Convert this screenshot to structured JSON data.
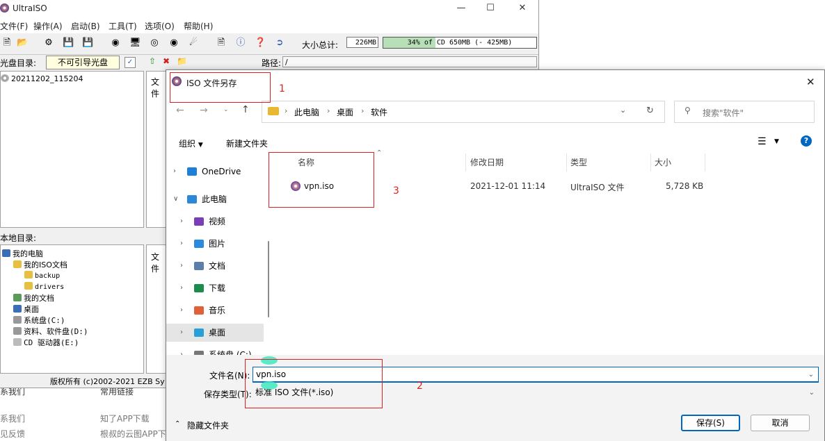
{
  "background_page": {
    "heading_left": "系我们",
    "heading_right": "常用链接",
    "links_left": [
      "系我们",
      "见反馈"
    ],
    "links_right": [
      "知了APP下载",
      "根叔的云图APP下载"
    ]
  },
  "ultraiso": {
    "title": "UltraISO",
    "menu": [
      "文件(F)",
      "操作(A)",
      "启动(B)",
      "工具(T)",
      "选项(O)",
      "帮助(H)"
    ],
    "size_label": "大小总计:",
    "size_value": "226MB",
    "capacity_text": "34% of CD 650MB (- 425MB)",
    "capacity_percent": 34,
    "disc_dir_label": "光盘目录:",
    "boot_status": "不可引导光盘",
    "path_label": "路径:",
    "path_value": "/",
    "disc_tree": [
      "20211202_115204"
    ],
    "file_col_label": "文件",
    "local_dir_label": "本地目录:",
    "local_tree": [
      {
        "label": "我的电脑",
        "level": 0
      },
      {
        "label": "我的ISO文档",
        "level": 1
      },
      {
        "label": "backup",
        "level": 2
      },
      {
        "label": "drivers",
        "level": 2
      },
      {
        "label": "我的文档",
        "level": 1
      },
      {
        "label": "桌面",
        "level": 1
      },
      {
        "label": "系统盘(C:)",
        "level": 1
      },
      {
        "label": "资料、软件盘(D:)",
        "level": 1
      },
      {
        "label": "CD 驱动器(E:)",
        "level": 1
      }
    ],
    "copyright": "版权所有 (c)2002-2021 EZB Sy"
  },
  "dialog": {
    "title": "ISO 文件另存",
    "breadcrumb": [
      "此电脑",
      "桌面",
      "软件"
    ],
    "search_placeholder": "搜索\"软件\"",
    "organize": "组织",
    "new_folder": "新建文件夹",
    "nav_items": [
      {
        "label": "OneDrive",
        "icon": "cloud-icon",
        "color": "#1e7fd8",
        "expanded": false
      },
      {
        "label": "此电脑",
        "icon": "computer-icon",
        "color": "#2b88d8",
        "expanded": true
      },
      {
        "label": "视频",
        "icon": "video-icon",
        "color": "#7a3fb8",
        "expanded": false
      },
      {
        "label": "图片",
        "icon": "picture-icon",
        "color": "#2a8ae0",
        "expanded": false
      },
      {
        "label": "文档",
        "icon": "document-icon",
        "color": "#5a7fa8",
        "expanded": false
      },
      {
        "label": "下载",
        "icon": "download-icon",
        "color": "#1c8c4c",
        "expanded": false
      },
      {
        "label": "音乐",
        "icon": "music-icon",
        "color": "#e0603a",
        "expanded": false
      },
      {
        "label": "桌面",
        "icon": "desktop-icon",
        "color": "#27a0d8",
        "expanded": false,
        "selected": true
      },
      {
        "label": "系统盘 (C:)",
        "icon": "drive-icon",
        "color": "#777777",
        "expanded": false
      }
    ],
    "columns": [
      "名称",
      "修改日期",
      "类型",
      "大小"
    ],
    "files": [
      {
        "name": "vpn.iso",
        "modified": "2021-12-01 11:14",
        "type": "UltraISO 文件",
        "size": "5,728 KB"
      }
    ],
    "filename_label": "文件名(N):",
    "filename_value": "vpn.iso",
    "filetype_label": "保存类型(T):",
    "filetype_value": "标准 ISO 文件(*.iso)",
    "hide_folders": "隐藏文件夹",
    "save_button": "保存(S)",
    "cancel_button": "取消"
  },
  "annotations": [
    "1",
    "2",
    "3"
  ],
  "colors": {
    "annotation_red": "#e02020",
    "selection_bg": "#e5e5e5",
    "accent_blue": "#0067c0"
  }
}
